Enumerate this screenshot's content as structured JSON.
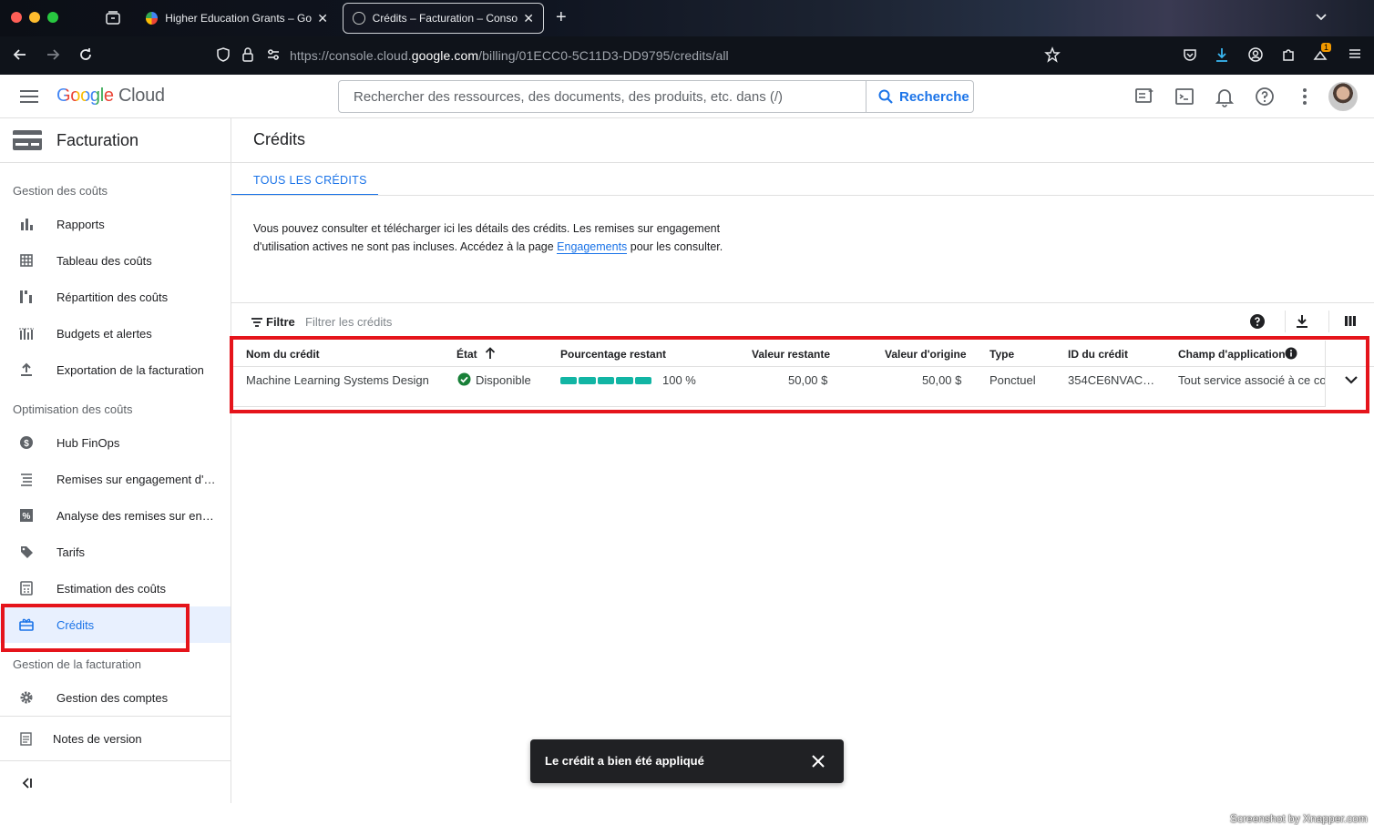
{
  "browser": {
    "tabs": [
      {
        "title": "Higher Education Grants – Goog",
        "active": false
      },
      {
        "title": "Crédits – Facturation – Console",
        "active": true
      }
    ],
    "url_prefix": "https://console.cloud.",
    "url_domain": "google.com",
    "url_path": "/billing/01ECC0-5C11D3-DD9795/credits/all",
    "download_badge": "1"
  },
  "header": {
    "logo_google": "Google",
    "logo_cloud": "Cloud",
    "search_placeholder": "Rechercher des ressources, des documents, des produits, etc. dans (/)",
    "search_button": "Recherche"
  },
  "sidebar": {
    "title": "Facturation",
    "sections": [
      {
        "label": "Gestion des coûts"
      },
      {
        "label": "Optimisation des coûts"
      },
      {
        "label": "Gestion de la facturation"
      }
    ],
    "items": [
      {
        "label": "Rapports",
        "icon": "bar-chart-icon"
      },
      {
        "label": "Tableau des coûts",
        "icon": "table-icon"
      },
      {
        "label": "Répartition des coûts",
        "icon": "breakdown-icon"
      },
      {
        "label": "Budgets et alertes",
        "icon": "budget-icon"
      },
      {
        "label": "Exportation de la facturation",
        "icon": "export-icon"
      },
      {
        "label": "Hub FinOps",
        "icon": "dollar-icon"
      },
      {
        "label": "Remises sur engagement d'utilisation",
        "icon": "list-icon"
      },
      {
        "label": "Analyse des remises sur engagement",
        "icon": "percent-icon"
      },
      {
        "label": "Tarifs",
        "icon": "tag-icon"
      },
      {
        "label": "Estimation des coûts",
        "icon": "calculator-icon"
      },
      {
        "label": "Crédits",
        "icon": "gift-icon",
        "active": true
      },
      {
        "label": "Gestion des comptes",
        "icon": "gear-icon"
      },
      {
        "label": "Notes de version",
        "icon": "notes-icon"
      }
    ]
  },
  "main": {
    "title": "Crédits",
    "tab": "TOUS LES CRÉDITS",
    "description_1": "Vous pouvez consulter et télécharger ici les détails des crédits. Les remises sur engagement d'utilisation actives ne sont pas incluses. Accédez à la page ",
    "description_link": "Engagements",
    "description_2": " pour les consulter.",
    "filter_label": "Filtre",
    "filter_placeholder": "Filtrer les crédits",
    "columns": [
      "Nom du crédit",
      "État",
      "Pourcentage restant",
      "Valeur restante",
      "Valeur d'origine",
      "Type",
      "ID du crédit",
      "Champ d'application"
    ],
    "rows": [
      {
        "name": "Machine Learning Systems Design",
        "status": "Disponible",
        "percent_remaining": "100 %",
        "percent_value": 100,
        "remaining_value": "50,00 $",
        "original_value": "50,00 $",
        "type": "Ponctuel",
        "credit_id": "354CE6NVAC…",
        "scope": "Tout service associé à ce co"
      }
    ]
  },
  "snackbar": {
    "message": "Le crédit a bien été appliqué"
  },
  "watermark": "Screenshot by Xnapper.com",
  "colors": {
    "accent": "#1a73e8",
    "progress": "#12b5a4",
    "highlight": "#e5141b",
    "status_ok": "#188038"
  }
}
